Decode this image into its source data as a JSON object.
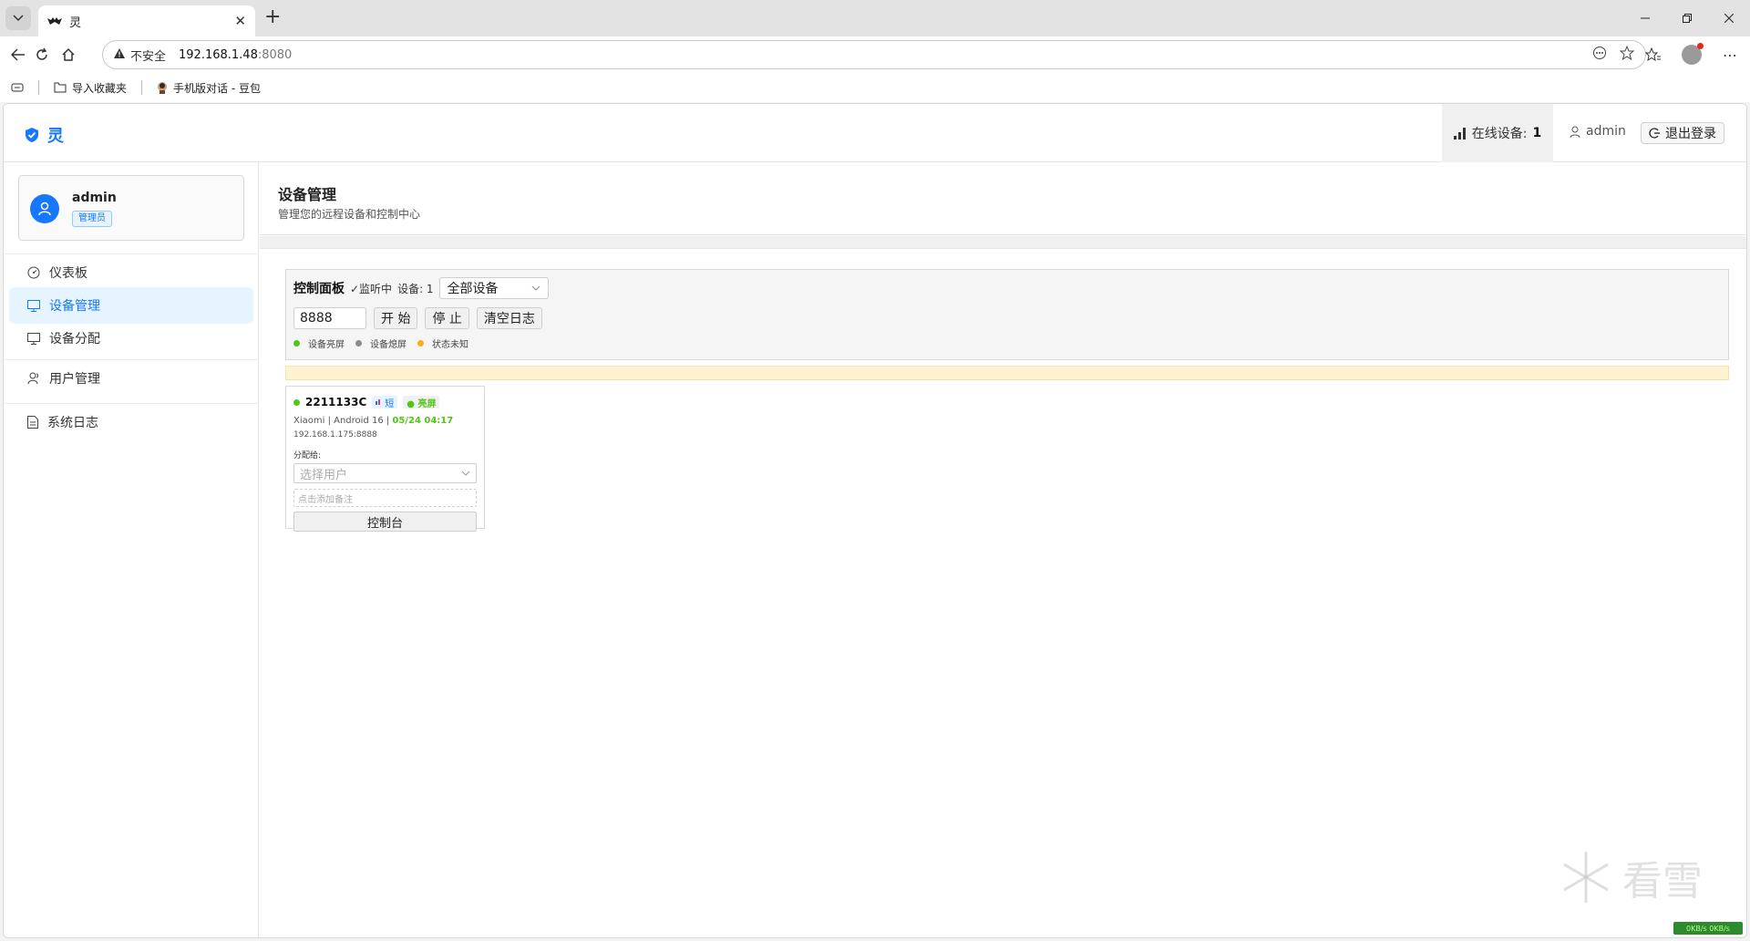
{
  "browser": {
    "tab_title": "灵",
    "url_warning": "不安全",
    "url_host": "192.168.1.48",
    "url_port": ":8080",
    "bookmarks": [
      {
        "label": "导入收藏夹"
      },
      {
        "label": "手机版对话 - 豆包"
      }
    ]
  },
  "app": {
    "brand": "灵",
    "header": {
      "online_label": "在线设备:",
      "online_count": "1",
      "username": "admin",
      "logout_label": "退出登录"
    },
    "sidebar": {
      "user_name": "admin",
      "user_role": "管理员",
      "items": [
        {
          "label": "仪表板"
        },
        {
          "label": "设备管理"
        },
        {
          "label": "设备分配"
        },
        {
          "label": "用户管理"
        },
        {
          "label": "系统日志"
        }
      ]
    },
    "page": {
      "title": "设备管理",
      "subtitle": "管理您的远程设备和控制中心"
    },
    "control_panel": {
      "title": "控制面板",
      "listening": "✓监听中",
      "device_count": "设备: 1",
      "filter_value": "全部设备",
      "port_value": "8888",
      "start_label": "开 始",
      "stop_label": "停 止",
      "clear_label": "清空日志",
      "legend": [
        {
          "label": "设备亮屏",
          "color": "#52c41a"
        },
        {
          "label": "设备熄屏",
          "color": "#8c8c8c"
        },
        {
          "label": "状态未知",
          "color": "#faad14"
        }
      ]
    },
    "devices": [
      {
        "id": "2211133C",
        "tag_short": "短",
        "tag_screen": "● 亮屏",
        "meta": "Xiaomi | Android 16 |",
        "time": "05/24 04:17",
        "address": "192.168.1.175:8888",
        "assign_label": "分配给:",
        "assign_placeholder": "选择用户",
        "note_placeholder": "点击添加备注",
        "console_label": "控制台"
      }
    ]
  },
  "overlay": {
    "watermark_text": "看雪",
    "badge_text": "0KB/s 0KB/s"
  }
}
